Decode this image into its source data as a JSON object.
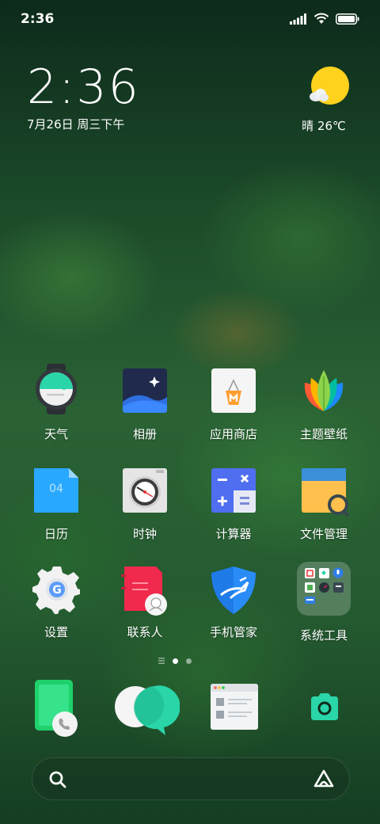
{
  "status_bar": {
    "time": "2:36"
  },
  "clock_widget": {
    "time": "2:36",
    "date": "7月26日 周三下午"
  },
  "weather_widget": {
    "condition": "晴",
    "temperature": "26℃"
  },
  "apps": [
    {
      "label": "天气"
    },
    {
      "label": "相册"
    },
    {
      "label": "应用商店"
    },
    {
      "label": "主题壁纸"
    },
    {
      "label": "日历",
      "icon_text": "04"
    },
    {
      "label": "时钟"
    },
    {
      "label": "计算器"
    },
    {
      "label": "文件管理"
    },
    {
      "label": "设置"
    },
    {
      "label": "联系人"
    },
    {
      "label": "手机管家"
    },
    {
      "label": "系统工具"
    }
  ],
  "pages": {
    "total": 2,
    "current": 1
  },
  "dock": [
    "phone",
    "messages",
    "browser",
    "camera"
  ],
  "colors": {
    "accent_green": "#2ad5a8",
    "sun_yellow": "#ffd21e"
  }
}
